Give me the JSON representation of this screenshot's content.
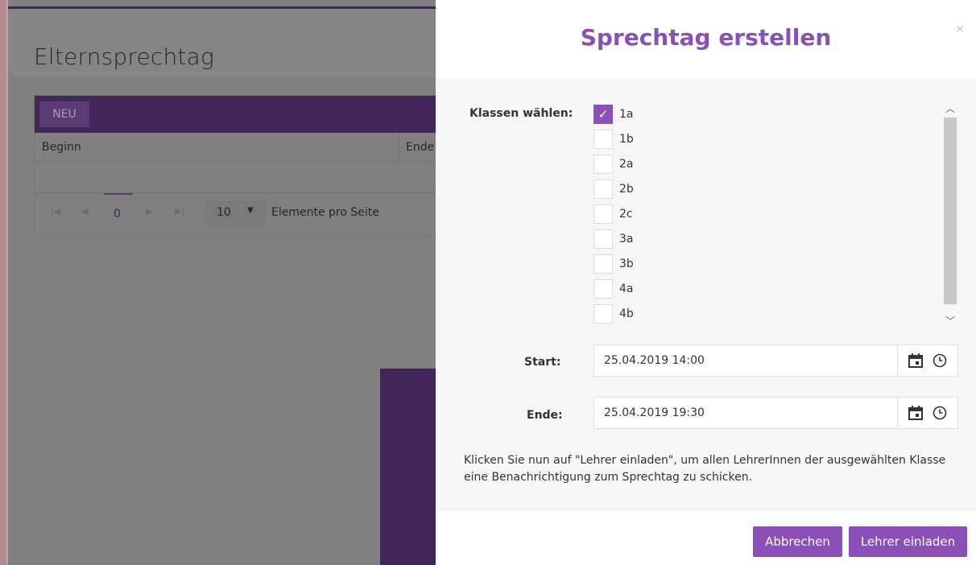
{
  "background": {
    "page_title": "Elternsprechtag",
    "toolbar": {
      "new_label": "NEU"
    },
    "columns": [
      "Beginn",
      "Ende"
    ],
    "pager": {
      "first": "|◀",
      "prev": "◀",
      "page": "0",
      "next": "▶",
      "last": "▶|",
      "page_size": "10",
      "page_size_arrow": "▼",
      "per_page_label": "Elemente pro Seite"
    }
  },
  "modal": {
    "title": "Sprechtag erstellen",
    "close": "×",
    "classes_label": "Klassen wählen:",
    "classes": [
      {
        "label": "1a",
        "checked": true
      },
      {
        "label": "1b",
        "checked": false
      },
      {
        "label": "2a",
        "checked": false
      },
      {
        "label": "2b",
        "checked": false
      },
      {
        "label": "2c",
        "checked": false
      },
      {
        "label": "3a",
        "checked": false
      },
      {
        "label": "3b",
        "checked": false
      },
      {
        "label": "4a",
        "checked": false
      },
      {
        "label": "4b",
        "checked": false
      }
    ],
    "start_label": "Start:",
    "start_value": "25.04.2019 14:00",
    "end_label": "Ende:",
    "end_value": "25.04.2019 19:30",
    "hint": "Klicken Sie nun auf \"Lehrer einladen\", um allen LehrerInnen der ausgewählten Klasse eine Benachrichtigung zum Sprechtag zu schicken.",
    "cancel_label": "Abbrechen",
    "invite_label": "Lehrer einladen"
  },
  "icons": {
    "calendar": "calendar-icon",
    "clock": "clock-icon",
    "check": "checkmark-icon"
  },
  "colors": {
    "accent": "#8b4fb8",
    "toolbar": "#432659"
  }
}
